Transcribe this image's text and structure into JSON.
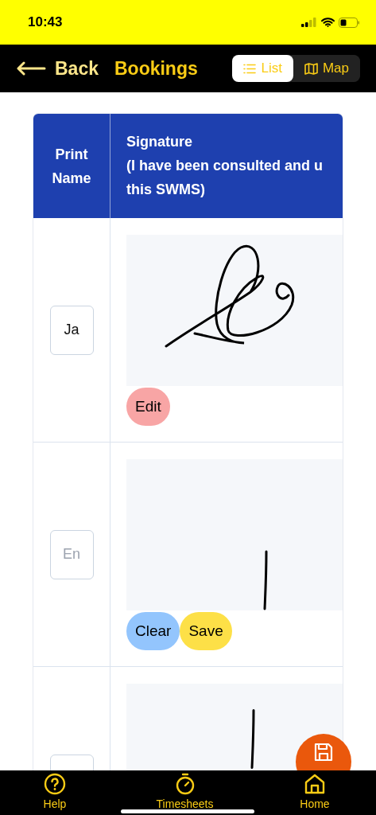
{
  "status_bar": {
    "time": "10:43"
  },
  "header": {
    "back": "Back",
    "title": "Bookings",
    "views": [
      {
        "label": "List",
        "kind": "list",
        "selected": true
      },
      {
        "label": "Map",
        "kind": "map",
        "selected": false
      }
    ]
  },
  "table": {
    "columns": [
      {
        "lines": [
          "Print",
          "Name"
        ]
      },
      {
        "lines": [
          "Signature",
          "(I have been consulted and u",
          "this SWMS)"
        ]
      }
    ],
    "rows": [
      {
        "name": {
          "value": "Ja"
        },
        "buttons": [
          {
            "label": "Edit",
            "kind": "edit"
          }
        ]
      },
      {
        "name": {
          "placeholder": "En"
        },
        "buttons": [
          {
            "label": "Clear",
            "kind": "clear"
          },
          {
            "label": "Save",
            "kind": "save"
          }
        ]
      },
      {
        "name": {},
        "buttons": []
      }
    ]
  },
  "tab_bar": [
    {
      "label": "Help",
      "kind": "help"
    },
    {
      "label": "Timesheets",
      "kind": "timer"
    },
    {
      "label": "Home",
      "kind": "home"
    }
  ]
}
